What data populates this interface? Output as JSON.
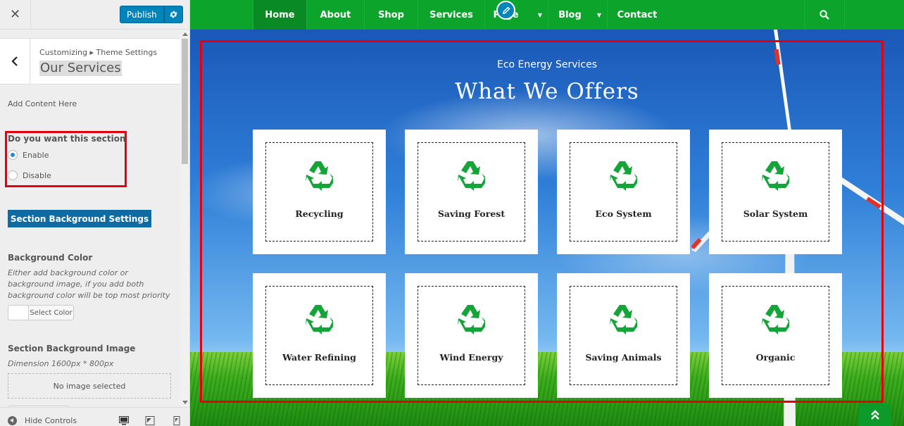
{
  "customizer": {
    "close_icon": "close-icon",
    "publish_label": "Publish",
    "settings_icon": "gear-icon",
    "breadcrumb": "Customizing ▸ Theme Settings",
    "section_title": "Our Services",
    "add_content": "Add Content Here",
    "section_toggle": {
      "title": "Do you want this section",
      "options": [
        "Enable",
        "Disable"
      ],
      "selected": "Enable"
    },
    "bg_settings_button": "Section Background Settings",
    "bg_color": {
      "title": "Background Color",
      "description": "Either add background color or background image, if you add both background color will be top most priority",
      "select_label": "Select Color"
    },
    "bg_image": {
      "title": "Section Background Image",
      "dimension": "Dimension 1600px * 800px",
      "no_image": "No image selected"
    },
    "footer": {
      "hide_controls": "Hide Controls"
    }
  },
  "preview": {
    "nav": {
      "items": [
        {
          "label": "Home",
          "active": true
        },
        {
          "label": "About"
        },
        {
          "label": "Shop"
        },
        {
          "label": "Services"
        },
        {
          "label": "Page",
          "dropdown": true
        },
        {
          "label": "Blog",
          "dropdown": true
        },
        {
          "label": "Contact"
        }
      ],
      "search_icon": "search-icon"
    },
    "section": {
      "subtitle": "Eco Energy Services",
      "heading": "What We Offers",
      "services": [
        {
          "label": "Recycling",
          "icon": "recycle-icon"
        },
        {
          "label": "Saving Forest",
          "icon": "recycle-icon"
        },
        {
          "label": "Eco System",
          "icon": "recycle-icon"
        },
        {
          "label": "Solar System",
          "icon": "recycle-icon"
        },
        {
          "label": "Water Refining",
          "icon": "recycle-icon"
        },
        {
          "label": "Wind Energy",
          "icon": "recycle-icon"
        },
        {
          "label": "Saving Animals",
          "icon": "recycle-icon"
        },
        {
          "label": "Organic",
          "icon": "recycle-icon"
        }
      ]
    },
    "colors": {
      "nav_green": "#0da42c",
      "icon_green": "#13a538",
      "publish_blue": "#0085ba",
      "highlight_red": "#e3000f"
    }
  }
}
